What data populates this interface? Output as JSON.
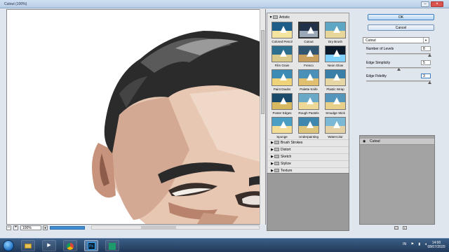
{
  "window": {
    "title": "Cutout (100%)"
  },
  "zoom": {
    "value": "100%",
    "minus": "−",
    "plus": "+",
    "progress": 1.0
  },
  "gallery": {
    "category": "Artistic",
    "filters": [
      {
        "label": "Colored Pencil"
      },
      {
        "label": "Cutout",
        "selected": true
      },
      {
        "label": "Dry Brush"
      },
      {
        "label": "Film Grain"
      },
      {
        "label": "Fresco"
      },
      {
        "label": "Neon Glow"
      },
      {
        "label": "Paint Daubs"
      },
      {
        "label": "Palette Knife"
      },
      {
        "label": "Plastic Wrap"
      },
      {
        "label": "Poster Edges"
      },
      {
        "label": "Rough Pastels"
      },
      {
        "label": "Smudge Stick"
      },
      {
        "label": "Sponge"
      },
      {
        "label": "Underpainting"
      },
      {
        "label": "Watercolor"
      }
    ],
    "categories": [
      "Brush Strokes",
      "Distort",
      "Sketch",
      "Stylize",
      "Texture"
    ]
  },
  "buttons": {
    "ok": "OK",
    "cancel": "Cancel"
  },
  "filter_select": {
    "value": "Cutout"
  },
  "params": [
    {
      "label": "Number of Levels",
      "value": "8",
      "level": 8,
      "max": 8
    },
    {
      "label": "Edge Simplicity",
      "value": "5",
      "level": 5,
      "max": 10
    },
    {
      "label": "Edge Fidelity",
      "value": "3",
      "level": 3,
      "max": 3
    }
  ],
  "layers": [
    {
      "name": "Cutout"
    }
  ],
  "taskbar": {
    "apps": [
      "file-explorer-icon",
      "media-player-icon",
      "chrome-icon",
      "photoshop-icon",
      "app-icon"
    ],
    "photoshop_label": "Ps",
    "tray_lang": "IN",
    "time": "14:00",
    "date": "08/07/2020"
  },
  "colors": {
    "hair": "#2a2a2a",
    "skin_light": "#e8c8b4",
    "skin_mid": "#c99a82",
    "skin_dark": "#8a5a48",
    "accent": "#3c7fc4"
  }
}
